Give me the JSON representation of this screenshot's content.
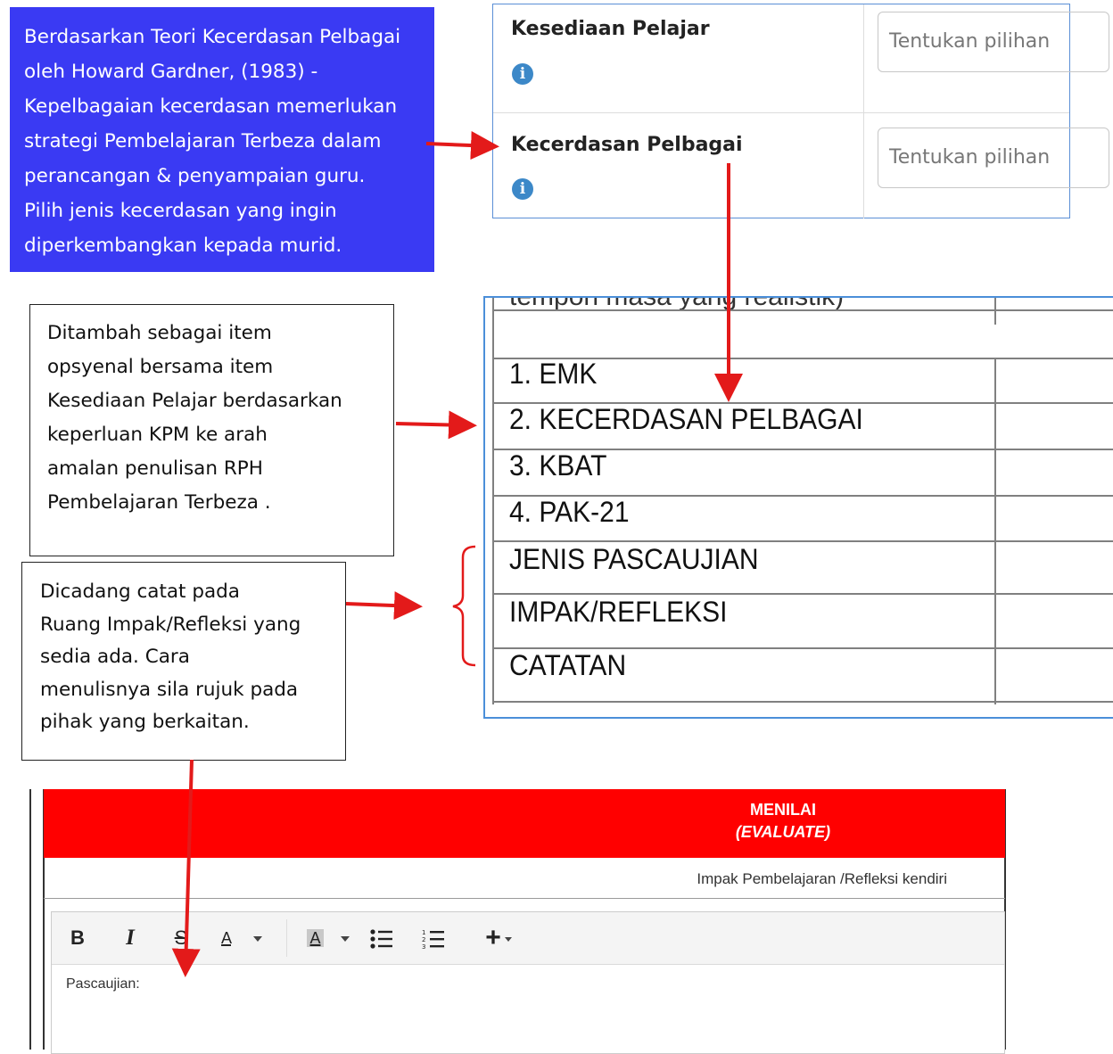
{
  "gardner_callout": {
    "lines": [
      "Berdasarkan Teori Kecerdasan Pelbagai",
      "oleh Howard Gardner, (1983) -",
      "Kepelbagaian kecerdasan memerlukan",
      "strategi Pembelajaran Terbeza dalam",
      "perancangan & penyampaian guru.",
      "Pilih jenis kecerdasan yang ingin",
      "diperkembangkan kepada murid."
    ],
    "bg_color": "#3a3af3"
  },
  "form": {
    "rows": [
      {
        "label": "Kesediaan Pelajar",
        "placeholder": "Tentukan pilihan"
      },
      {
        "label": "Kecerdasan Pelbagai",
        "placeholder": "Tentukan pilihan"
      }
    ],
    "info_icon": "info-circle-icon"
  },
  "note_optional": {
    "lines": [
      "Ditambah sebagai item",
      "opsyenal bersama item",
      "Kesediaan Pelajar berdasarkan",
      "keperluan KPM ke arah",
      "amalan penulisan RPH",
      "Pembelajaran Terbeza ."
    ]
  },
  "note_reflection": {
    "lines": [
      "Dicadang catat pada",
      "Ruang Impak/Refleksi yang",
      "sedia ada. Cara",
      "menulisnya sila rujuk pada",
      "pihak yang berkaitan."
    ]
  },
  "rph_table": {
    "cut_off_text": "tempoh masa yang realistik)",
    "rows": [
      "1.  EMK",
      "2.  KECERDASAN PELBAGAI",
      "3.  KBAT",
      "4.  PAK-21",
      "JENIS PASCAUJIAN",
      "IMPAK/REFLEKSI",
      "CATATAN"
    ]
  },
  "editor": {
    "header_title": "MENILAI",
    "header_subtitle": "(EVALUATE)",
    "header_color": "#ff0000",
    "subheading": "Impak Pembelajaran /Refleksi kendiri",
    "toolbar": {
      "bold": "B",
      "italic": "I",
      "strike": "S",
      "font_color": "A",
      "highlight": "A",
      "add": "+"
    },
    "content": "Pascaujian:"
  },
  "arrow_color": "#e31a1a"
}
